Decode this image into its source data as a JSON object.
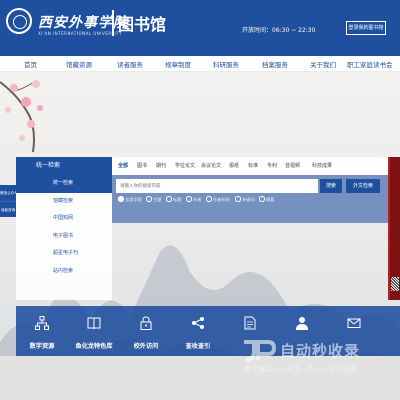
{
  "header": {
    "school_name": "西安外事学院",
    "school_name_en": "XI'AN INTERNATIONAL UNIVERSITY",
    "library_title": "图书馆",
    "open_hours": "开放时间：06:30 ~ 22:30",
    "login_label": "登录我的图书馆"
  },
  "nav": {
    "items": [
      "首页",
      "馆藏资源",
      "读者服务",
      "规章制度",
      "科研服务",
      "档案服务",
      "关于我们",
      "职工家庭读书会"
    ]
  },
  "left_menu": {
    "items": [
      "微信公众号",
      "读者咨询"
    ]
  },
  "side_panel": {
    "title": "统一检索",
    "items": [
      "统一检索",
      "馆藏检索",
      "中国知网",
      "电子图书",
      "超星电子刊",
      "站内检索"
    ]
  },
  "search": {
    "tabs": [
      "全部",
      "图书",
      "期刊",
      "学位论文",
      "会议论文",
      "报纸",
      "标准",
      "专利",
      "音视频",
      "科技成果"
    ],
    "placeholder": "请输入你的搜索内容",
    "search_label": "搜索",
    "foreign_label": "外文检索",
    "scope": [
      "全部字段",
      "主题",
      "标题",
      "作者",
      "作者机构",
      "关键词",
      "摘要"
    ],
    "scope_selected": "全部字段"
  },
  "quick_links": {
    "items": [
      {
        "label": "数字资源",
        "icon": "sitemap-icon"
      },
      {
        "label": "鱼化龙特色库",
        "icon": "book-open-icon"
      },
      {
        "label": "校外访问",
        "icon": "lock-icon"
      },
      {
        "label": "查收查引",
        "icon": "share-icon"
      },
      {
        "label": "",
        "icon": "document-icon"
      },
      {
        "label": "",
        "icon": "person-icon"
      },
      {
        "label": "",
        "icon": "mail-icon"
      }
    ]
  },
  "watermark": {
    "title": "自动秒收录",
    "subtitle": "做上链接——来访一次——自动收录"
  },
  "colors": {
    "primary": "#1f4f9f",
    "accent_red": "#7d1010"
  }
}
